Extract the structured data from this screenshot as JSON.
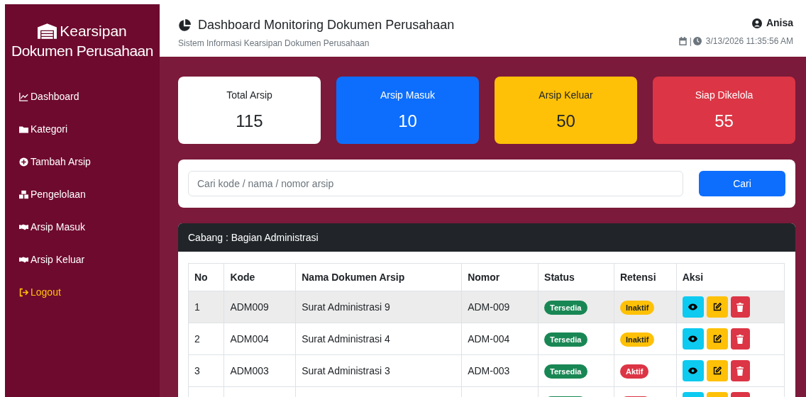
{
  "sidebar": {
    "brand": [
      "Kearsipan",
      "Dokumen Perusahaan"
    ],
    "items": [
      {
        "label": "Dashboard",
        "kind": "nav"
      },
      {
        "label": "Kategori",
        "kind": "nav"
      },
      {
        "label": "Tambah Arsip",
        "kind": "nav"
      },
      {
        "label": "Pengelolaan",
        "kind": "nav"
      },
      {
        "label": "Arsip Masuk",
        "kind": "nav"
      },
      {
        "label": "Arsip Keluar",
        "kind": "nav"
      },
      {
        "label": "Logout",
        "kind": "logout"
      }
    ]
  },
  "header": {
    "title": "Dashboard Monitoring Dokumen Perusahaan",
    "subtitle": "Sistem Informasi Kearsipan Dokumen Perusahaan",
    "user": "Anisa",
    "separator": "|",
    "datetime": "3/13/2026 11:35:56 AM"
  },
  "stats": [
    {
      "label": "Total Arsip",
      "value": "115",
      "color": "#ffffff"
    },
    {
      "label": "Arsip Masuk",
      "value": "10",
      "color": "#0d6efd"
    },
    {
      "label": "Arsip Keluar",
      "value": "50",
      "color": "#ffc107"
    },
    {
      "label": "Siap Dikelola",
      "value": "55",
      "color": "#dc3545"
    }
  ],
  "search": {
    "placeholder": "Cari kode / nama / nomor arsip",
    "button": "Cari"
  },
  "table": {
    "title": "Cabang : Bagian Administrasi",
    "columns": [
      "No",
      "Kode",
      "Nama Dokumen Arsip",
      "Nomor",
      "Status",
      "Retensi",
      "Aksi"
    ],
    "rows": [
      {
        "no": "1",
        "kode": "ADM009",
        "nama": "Surat Administrasi 9",
        "nomor": "ADM-009",
        "status": {
          "label": "Tersedia",
          "color": "#198754"
        },
        "retensi": {
          "label": "Inaktif",
          "color": "#ffc107"
        },
        "striped": true
      },
      {
        "no": "2",
        "kode": "ADM004",
        "nama": "Surat Administrasi 4",
        "nomor": "ADM-004",
        "status": {
          "label": "Tersedia",
          "color": "#198754"
        },
        "retensi": {
          "label": "Inaktif",
          "color": "#ffc107"
        },
        "striped": false
      },
      {
        "no": "3",
        "kode": "ADM003",
        "nama": "Surat Administrasi 3",
        "nomor": "ADM-003",
        "status": {
          "label": "Tersedia",
          "color": "#198754"
        },
        "retensi": {
          "label": "Aktif",
          "color": "#dc3545"
        },
        "striped": false
      },
      {
        "status": {
          "color": "#198754"
        },
        "retensi": {
          "color": "#dc3545"
        },
        "striped": false
      }
    ]
  }
}
